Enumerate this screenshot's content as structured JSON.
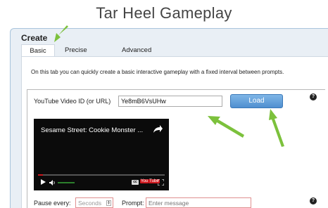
{
  "page": {
    "title": "Tar Heel Gameplay"
  },
  "create": {
    "label": "Create",
    "tabs": [
      {
        "label": "Basic",
        "active": true
      },
      {
        "label": "Precise",
        "active": false
      },
      {
        "label": "Advanced",
        "active": false
      }
    ],
    "description": "On this tab you can quickly create a basic interactive gameplay with a fixed interval between prompts."
  },
  "youtube": {
    "label": "YouTube Video ID (or URL)",
    "value": "Ye8mB6VsUHw",
    "load_label": "Load",
    "help": "?"
  },
  "video": {
    "title": "Sesame Street: Cookie Monster ...",
    "cc": "cc",
    "brand_you": "You",
    "brand_tube": "Tube",
    "progress": 0.04
  },
  "pause": {
    "label": "Pause every:",
    "placeholder": "Seconds",
    "prompt_label": "Prompt:",
    "prompt_placeholder": "Enter message",
    "help": "?"
  },
  "colors": {
    "arrow": "#7cc13c",
    "load_button": "#5b9bd8",
    "panel": "#e9eff5"
  }
}
